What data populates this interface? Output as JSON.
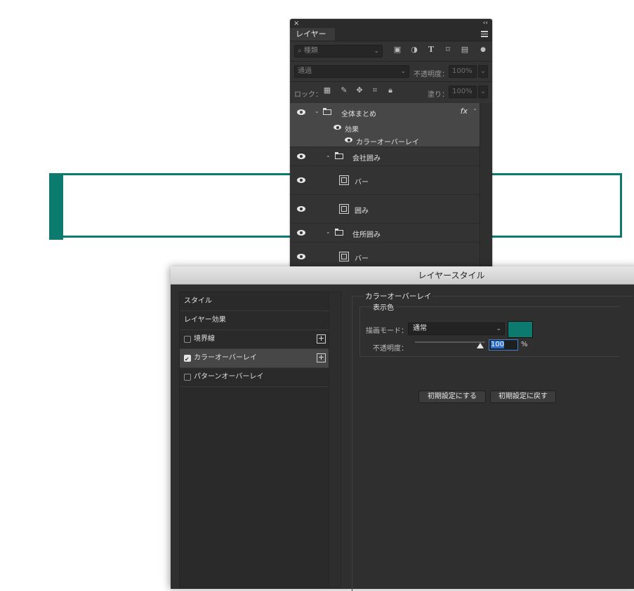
{
  "colors": {
    "accent": "#0c7a6e",
    "panel": "#333333",
    "dialog": "#2f2f2f"
  },
  "layers_panel": {
    "close": "×",
    "collapse": "‹‹",
    "tab": "レイヤー",
    "filter": {
      "search_icon": "⌕",
      "placeholder": "種類"
    },
    "blend_mode": "通過",
    "opacity_label": "不透明度：",
    "opacity_value": "100%",
    "lock_label": "ロック：",
    "fill_label": "塗り：",
    "fill_value": "100%",
    "layers": [
      {
        "name": "全体まとめ",
        "type": "group",
        "fx": "fx",
        "effects_label": "効果",
        "effect": "カラーオーバーレイ"
      },
      {
        "name": "会社囲み",
        "type": "group"
      },
      {
        "name": "バー",
        "type": "shape"
      },
      {
        "name": "囲み",
        "type": "shape"
      },
      {
        "name": "住所囲み",
        "type": "group"
      },
      {
        "name": "バー",
        "type": "shape"
      }
    ]
  },
  "dialog": {
    "title": "レイヤースタイル",
    "left_items": [
      {
        "label": "スタイル"
      },
      {
        "label": "レイヤー効果"
      },
      {
        "label": "境界線",
        "checked": false
      },
      {
        "label": "カラーオーバーレイ",
        "checked": true
      },
      {
        "label": "パターンオーバーレイ",
        "checked": false
      }
    ],
    "group_title": "カラーオーバーレイ",
    "sub_title": "表示色",
    "blend_label": "描画モード：",
    "blend_value": "通常",
    "opacity_label": "不透明度：",
    "opacity_value": "100",
    "opacity_unit": "%",
    "btn_default": "初期設定にする",
    "btn_reset": "初期設定に戻す"
  }
}
